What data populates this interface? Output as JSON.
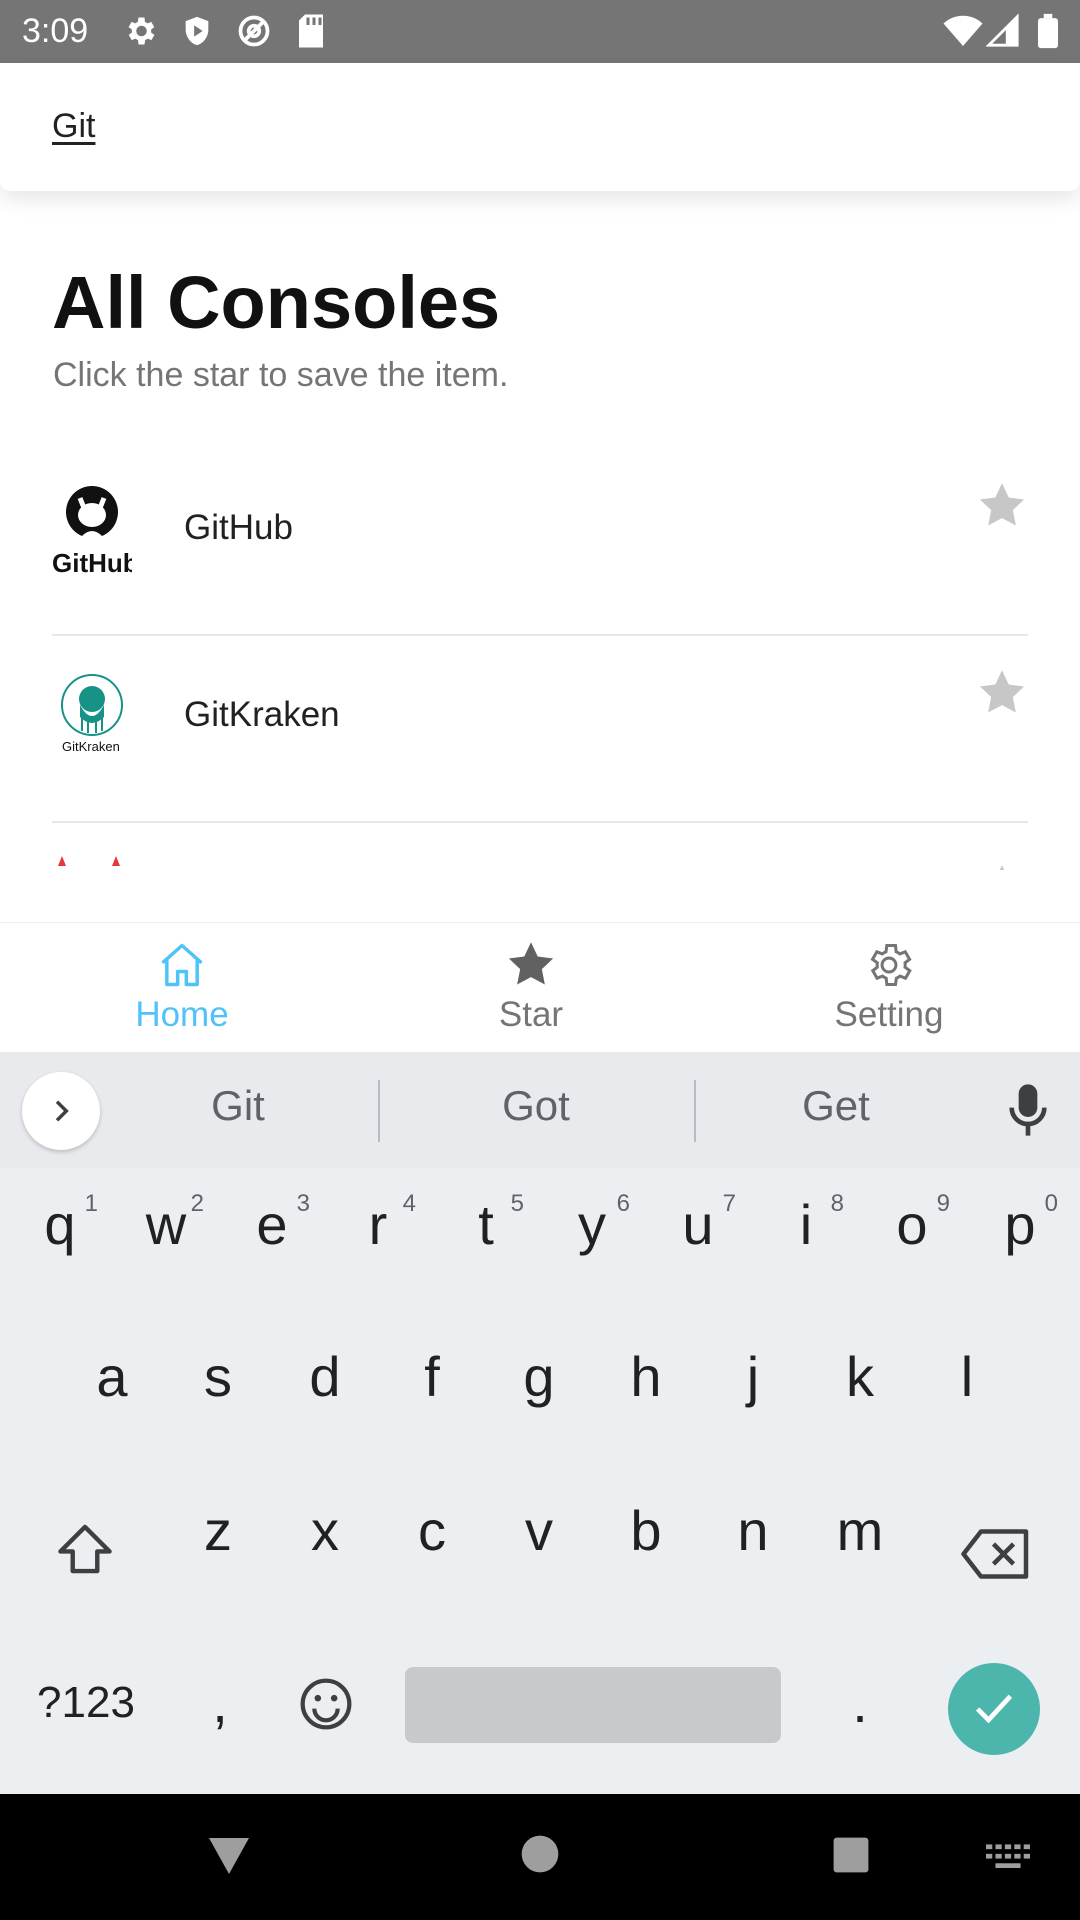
{
  "status_bar": {
    "time": "3:09",
    "icons": [
      "gear-icon",
      "shield-icon",
      "at-icon",
      "sd-card-icon",
      "wifi-icon",
      "signal-icon",
      "battery-icon"
    ]
  },
  "search": {
    "query": "Git"
  },
  "page": {
    "title": "All Consoles",
    "subtitle": "Click the star to save the item."
  },
  "consoles": [
    {
      "name": "GitHub",
      "logo": "github-logo",
      "logo_text": "GitHub"
    },
    {
      "name": "GitKraken",
      "logo": "gitkraken-logo",
      "logo_text": "GitKraken"
    },
    {
      "name": "",
      "logo": "partially-visible-logo"
    }
  ],
  "bottom_nav": {
    "items": [
      {
        "label": "Home",
        "icon": "home-icon",
        "active": true
      },
      {
        "label": "Star",
        "icon": "star-icon",
        "active": false
      },
      {
        "label": "Setting",
        "icon": "gear-icon",
        "active": false
      }
    ],
    "active_color": "#4fc3f7",
    "inactive_color": "#757575"
  },
  "keyboard": {
    "suggestions": [
      "Git",
      "Got",
      "Get"
    ],
    "row1": [
      {
        "key": "q",
        "hint": "1"
      },
      {
        "key": "w",
        "hint": "2"
      },
      {
        "key": "e",
        "hint": "3"
      },
      {
        "key": "r",
        "hint": "4"
      },
      {
        "key": "t",
        "hint": "5"
      },
      {
        "key": "y",
        "hint": "6"
      },
      {
        "key": "u",
        "hint": "7"
      },
      {
        "key": "i",
        "hint": "8"
      },
      {
        "key": "o",
        "hint": "9"
      },
      {
        "key": "p",
        "hint": "0"
      }
    ],
    "row2": [
      "a",
      "s",
      "d",
      "f",
      "g",
      "h",
      "j",
      "k",
      "l"
    ],
    "row3": [
      "z",
      "x",
      "c",
      "v",
      "b",
      "n",
      "m"
    ],
    "symbols_label": "?123",
    "comma": ",",
    "period": ".",
    "enter_color": "#4db6ac"
  }
}
